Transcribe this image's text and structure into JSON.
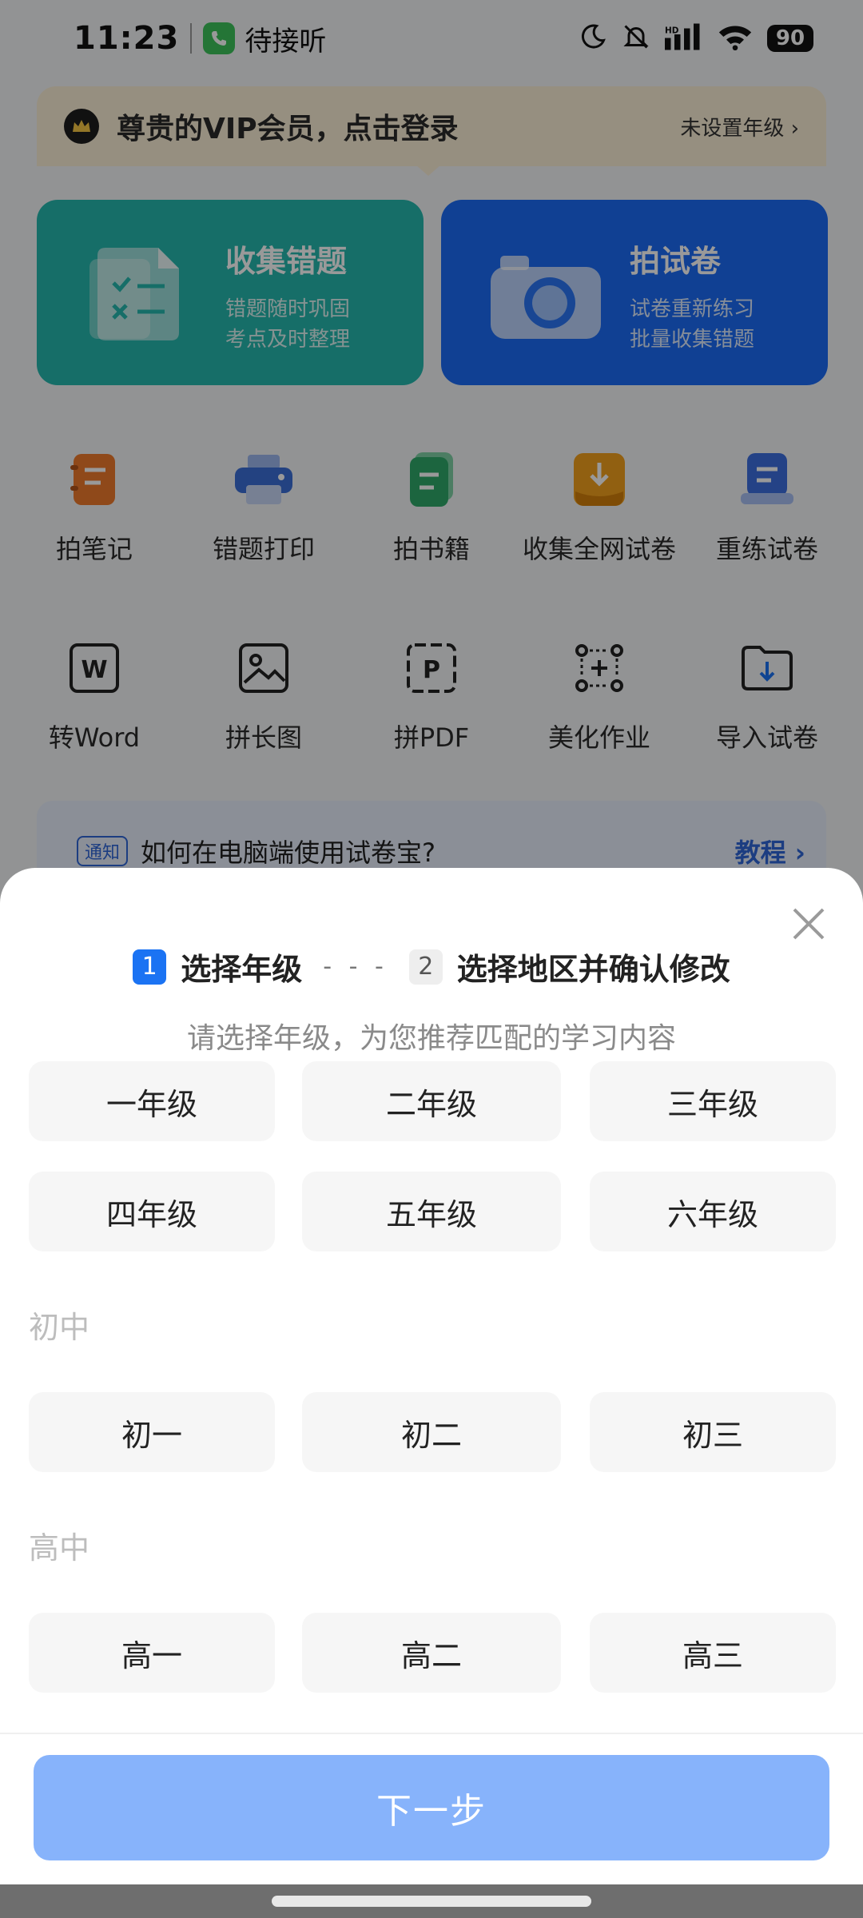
{
  "status_bar": {
    "time": "11:23",
    "call_label": "待接听",
    "battery": "90"
  },
  "vip": {
    "title": "尊贵的VIP会员，点击登录",
    "grade_link": "未设置年级 ›"
  },
  "cards": [
    {
      "title": "收集错题",
      "sub1": "错题随时巩固",
      "sub2": "考点及时整理"
    },
    {
      "title": "拍试卷",
      "sub1": "试卷重新练习",
      "sub2": "批量收集错题"
    }
  ],
  "tools_row1": [
    {
      "label": "拍笔记",
      "icon": "notebook-icon",
      "color": "#ef7a2c"
    },
    {
      "label": "错题打印",
      "icon": "printer-icon",
      "color": "#3b6fd8"
    },
    {
      "label": "拍书籍",
      "icon": "book-icon",
      "color": "#2fa96a"
    },
    {
      "label": "收集全网试卷",
      "icon": "download-icon",
      "color": "#f2a11d"
    },
    {
      "label": "重练试卷",
      "icon": "paper-stack-icon",
      "color": "#3d6fe0"
    }
  ],
  "tools_row2": [
    {
      "label": "转Word",
      "icon": "word-icon"
    },
    {
      "label": "拼长图",
      "icon": "image-icon"
    },
    {
      "label": "拼PDF",
      "icon": "pdf-icon"
    },
    {
      "label": "美化作业",
      "icon": "crop-icon"
    },
    {
      "label": "导入试卷",
      "icon": "folder-import-icon"
    }
  ],
  "notice": {
    "tag": "通知",
    "text": "如何在电脑端使用试卷宝?",
    "link": "教程 ›"
  },
  "sheet": {
    "step1_num": "1",
    "step1_label": "选择年级",
    "step_separator": "- - -",
    "step2_num": "2",
    "step2_label": "选择地区并确认修改",
    "subtitle": "请选择年级，为您推荐匹配的学习内容",
    "primary_grades": [
      "一年级",
      "二年级",
      "三年级",
      "四年级",
      "五年级",
      "六年级"
    ],
    "junior_label": "初中",
    "junior_grades": [
      "初一",
      "初二",
      "初三"
    ],
    "senior_label": "高中",
    "senior_grades": [
      "高一",
      "高二",
      "高三"
    ],
    "next_label": "下一步"
  },
  "colors": {
    "accent": "#1b73f3",
    "next_button": "#87b3fb",
    "collect_card": "#25b7ad",
    "exam_card": "#1c6cf5"
  }
}
